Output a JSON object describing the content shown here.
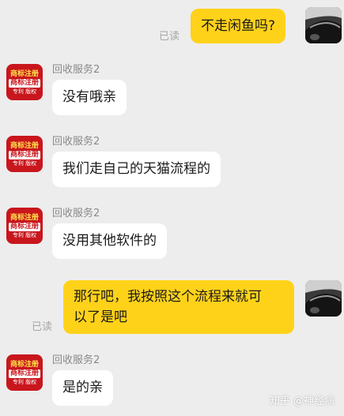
{
  "chat": {
    "messages": [
      {
        "direction": "out",
        "text": "不走闲鱼吗?",
        "read": "已读"
      },
      {
        "direction": "in",
        "sender": "回收服务2",
        "text": "没有哦亲"
      },
      {
        "direction": "in",
        "sender": "回收服务2",
        "text": "我们走自己的天猫流程的"
      },
      {
        "direction": "in",
        "sender": "回收服务2",
        "text": "没用其他软件的"
      },
      {
        "direction": "out",
        "text": "那行吧，我按照这个流程来就可以了是吧",
        "line1": "那行吧，我按照这个流程来就可",
        "line2": "以了是吧",
        "read": "已读"
      },
      {
        "direction": "in",
        "sender": "回收服务2",
        "text": "是的亲"
      }
    ]
  },
  "avatars": {
    "merchant": {
      "line1": "商标注册",
      "line2": "商标注册",
      "line3": "专利 版权",
      "icon": "brand-logo-avatar",
      "color": "#c9161d"
    },
    "user": {
      "icon": "car-photo-avatar"
    }
  },
  "colors": {
    "outgoing_bubble": "#ffd21a",
    "incoming_bubble": "#ffffff",
    "background": "#ededed"
  },
  "watermark": "知乎 @神经病"
}
